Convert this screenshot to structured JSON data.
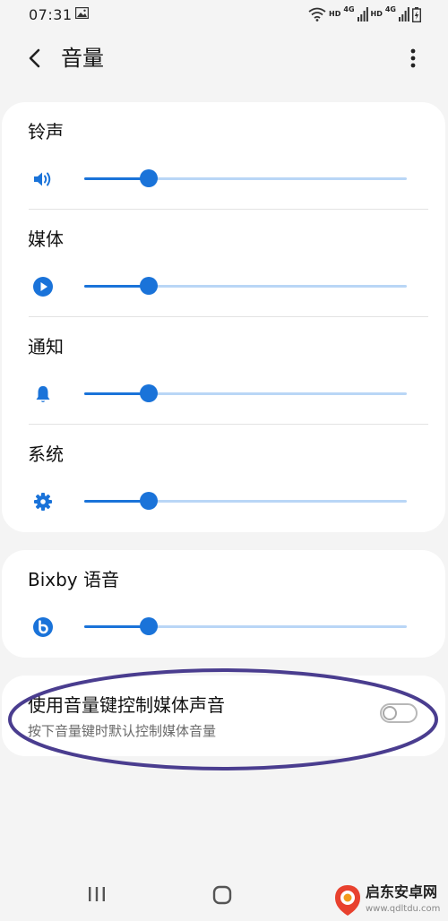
{
  "status_bar": {
    "time": "07:31",
    "net_label": "4G",
    "hd_label": "HD"
  },
  "header": {
    "title": "音量"
  },
  "volume_items": [
    {
      "label": "铃声",
      "icon": "speaker-icon",
      "level": 0.2
    },
    {
      "label": "媒体",
      "icon": "play-icon",
      "level": 0.2
    },
    {
      "label": "通知",
      "icon": "bell-icon",
      "level": 0.2
    },
    {
      "label": "系统",
      "icon": "gear-icon",
      "level": 0.2
    }
  ],
  "bixby": {
    "label": "Bixby 语音",
    "icon": "bixby-icon",
    "level": 0.2
  },
  "media_key_toggle": {
    "title": "使用音量键控制媒体声音",
    "subtitle": "按下音量键时默认控制媒体音量",
    "enabled": false
  },
  "watermark": {
    "title": "启东安卓网",
    "url": "www.qdltdu.com"
  },
  "colors": {
    "accent": "#1a73d9",
    "track": "#b9d6f6",
    "annotation": "#4a3d8f",
    "watermark_red": "#e8412e"
  }
}
